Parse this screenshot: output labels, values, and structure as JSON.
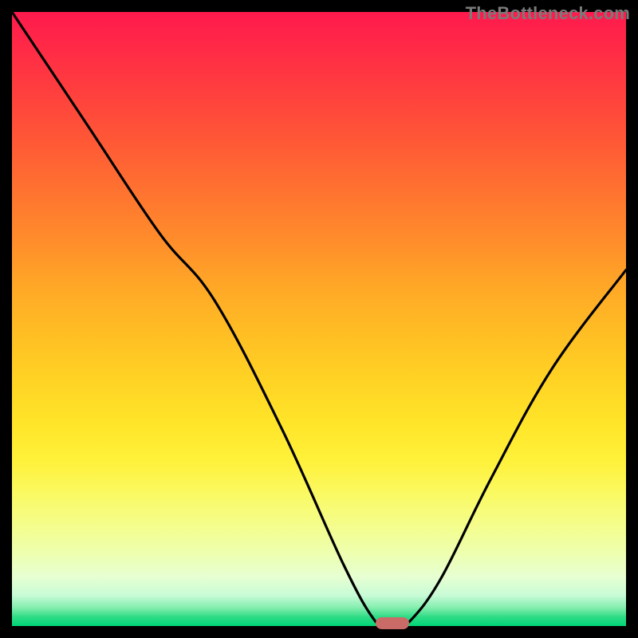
{
  "watermark": "TheBottleneck.com",
  "colors": {
    "frame": "#000000",
    "curve": "#000000",
    "marker": "#cb6b68",
    "gradient_top": "#ff1a4d",
    "gradient_bottom": "#00d577"
  },
  "chart_data": {
    "type": "line",
    "title": "",
    "xlabel": "",
    "ylabel": "",
    "xlim": [
      0,
      100
    ],
    "ylim": [
      0,
      100
    ],
    "series": [
      {
        "name": "bottleneck-curve",
        "x": [
          0,
          12,
          24,
          33,
          44,
          54,
          59,
          61,
          63,
          65,
          70,
          78,
          88,
          100
        ],
        "y": [
          100,
          82,
          64,
          53,
          32,
          10,
          1,
          0.5,
          0.5,
          1,
          8,
          24,
          42,
          58
        ]
      }
    ],
    "annotations": [
      {
        "name": "optimal-marker",
        "x": 62,
        "y": 0.5
      }
    ],
    "grid": false,
    "legend": false
  }
}
